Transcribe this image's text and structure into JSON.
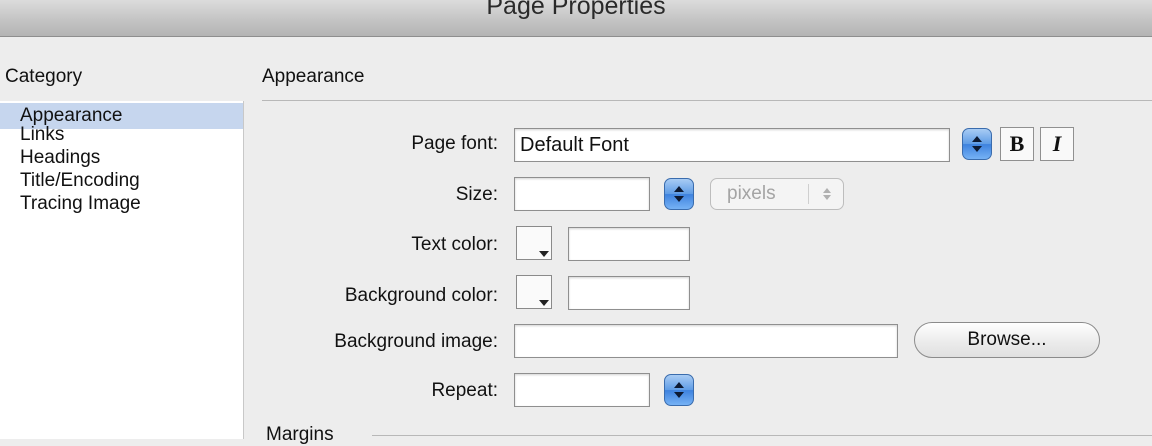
{
  "window": {
    "title": "Page Properties"
  },
  "category": {
    "header": "Category",
    "items": [
      {
        "label": "Appearance",
        "selected": true
      },
      {
        "label": "Links",
        "selected": false
      },
      {
        "label": "Headings",
        "selected": false
      },
      {
        "label": "Title/Encoding",
        "selected": false
      },
      {
        "label": "Tracing Image",
        "selected": false
      }
    ]
  },
  "section": {
    "title": "Appearance"
  },
  "fields": {
    "page_font": {
      "label": "Page font:",
      "value": "Default Font"
    },
    "bold_label": "B",
    "italic_label": "I",
    "size": {
      "label": "Size:",
      "value": "",
      "units": "pixels"
    },
    "text_color": {
      "label": "Text color:",
      "value": ""
    },
    "background_color": {
      "label": "Background color:",
      "value": ""
    },
    "background_image": {
      "label": "Background image:",
      "value": "",
      "browse_label": "Browse..."
    },
    "repeat": {
      "label": "Repeat:",
      "value": ""
    }
  },
  "margins": {
    "label": "Margins"
  },
  "colors": {
    "selection": "#c6d6ee",
    "accent": "#3e82de"
  },
  "icons": [
    "up-down-arrows-icon",
    "swatch-dropdown-icon"
  ]
}
